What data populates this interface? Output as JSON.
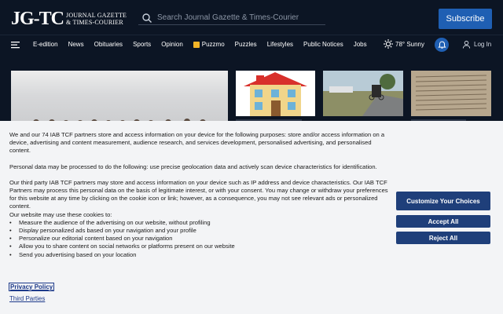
{
  "header": {
    "logo_mark": "JG-TC",
    "logo_line1": "Journal Gazette",
    "logo_line2": "& Times-Courier",
    "search_placeholder": "Search Journal Gazette & Times-Courier",
    "subscribe_label": "Subscribe"
  },
  "nav": {
    "items": [
      "E-edition",
      "News",
      "Obituaries",
      "Sports",
      "Opinion",
      "Puzzmo",
      "Puzzles",
      "Lifestyles",
      "Public Notices",
      "Jobs"
    ],
    "weather": "78° Sunny",
    "login_label": "Log In"
  },
  "consent": {
    "para1": "We and our 74 IAB TCF partners store and access information on your device for the following purposes: store and/or access information on a device, advertising and content measurement, audience research, and services development, personalised advertising, and personalised content.",
    "para2": "Personal data may be processed to do the following: use precise geolocation data and actively scan device characteristics for identification.",
    "para3": "Our third party IAB TCF partners may store and access information on your device such as IP address and device characteristics. Our IAB TCF Partners may process this personal data on the basis of legitimate interest, or with your consent. You may change or withdraw your preferences for this website at any time by clicking on the cookie icon or link; however, as a consequence, you may not see relevant ads or personalized content.",
    "cookies_intro": "Our website may use these cookies to:",
    "cookie_uses": [
      "Measure the audience of the advertising on our website, without profiling",
      "Display personalized ads based on your navigation and your profile",
      "Personalize our editorial content based on your navigation",
      "Allow you to share content on social networks or platforms present on our website",
      "Send you advertising based on your location"
    ],
    "privacy_link": "Privacy Policy",
    "third_parties_link": "Third Parties",
    "customize_label": "Customize Your Choices",
    "accept_label": "Accept All",
    "reject_label": "Reject All"
  },
  "icons": {
    "search": "search-icon",
    "menu": "menu-icon",
    "weather": "sun-icon",
    "bell": "bell-icon",
    "user": "user-icon"
  },
  "colors": {
    "header_bg": "#0c1524",
    "accent_blue": "#1f5fb3",
    "consent_bg": "#f3f4f6",
    "button_blue": "#1f3f7a",
    "link_blue": "#1d3a8a",
    "puzzmo_yellow": "#f2b428"
  }
}
